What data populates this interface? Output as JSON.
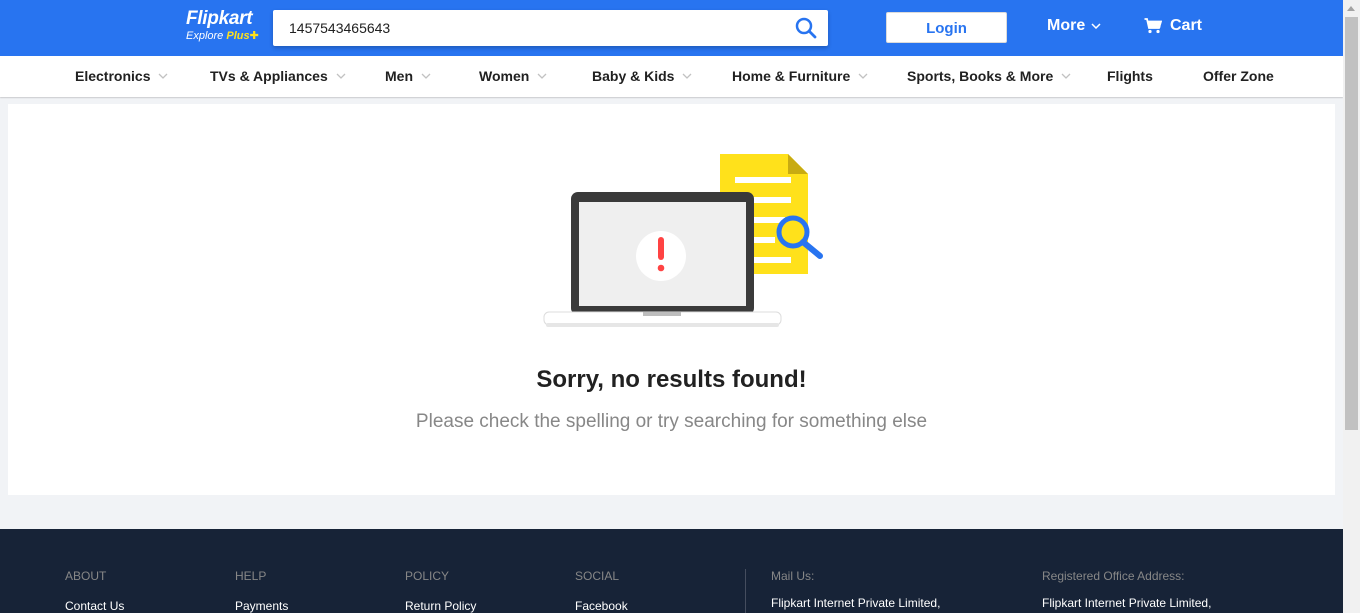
{
  "header": {
    "logo_main": "Flipkart",
    "logo_sub_prefix": "Explore ",
    "logo_sub_plus": "Plus",
    "search_value": "1457543465643",
    "login_label": "Login",
    "more_label": "More",
    "cart_label": "Cart",
    "colors": {
      "brand": "#2874f0",
      "accent": "#ffe11b"
    }
  },
  "categories": [
    {
      "label": "Electronics",
      "has_caret": true
    },
    {
      "label": "TVs & Appliances",
      "has_caret": true
    },
    {
      "label": "Men",
      "has_caret": true
    },
    {
      "label": "Women",
      "has_caret": true
    },
    {
      "label": "Baby & Kids",
      "has_caret": true
    },
    {
      "label": "Home & Furniture",
      "has_caret": true
    },
    {
      "label": "Sports, Books & More",
      "has_caret": true
    },
    {
      "label": "Flights",
      "has_caret": false
    },
    {
      "label": "Offer Zone",
      "has_caret": false
    }
  ],
  "main": {
    "title": "Sorry, no results found!",
    "subtitle": "Please check the spelling or try searching for something else",
    "illustration_icon": "laptop-error-search-icon"
  },
  "footer": {
    "columns": [
      {
        "heading": "ABOUT",
        "first_link": "Contact Us"
      },
      {
        "heading": "HELP",
        "first_link": "Payments"
      },
      {
        "heading": "POLICY",
        "first_link": "Return Policy"
      },
      {
        "heading": "SOCIAL",
        "first_link": "Facebook"
      }
    ],
    "mail_us": {
      "heading": "Mail Us:",
      "line1": "Flipkart Internet Private Limited,"
    },
    "registered": {
      "heading": "Registered Office Address:",
      "line1": "Flipkart Internet Private Limited,"
    }
  }
}
